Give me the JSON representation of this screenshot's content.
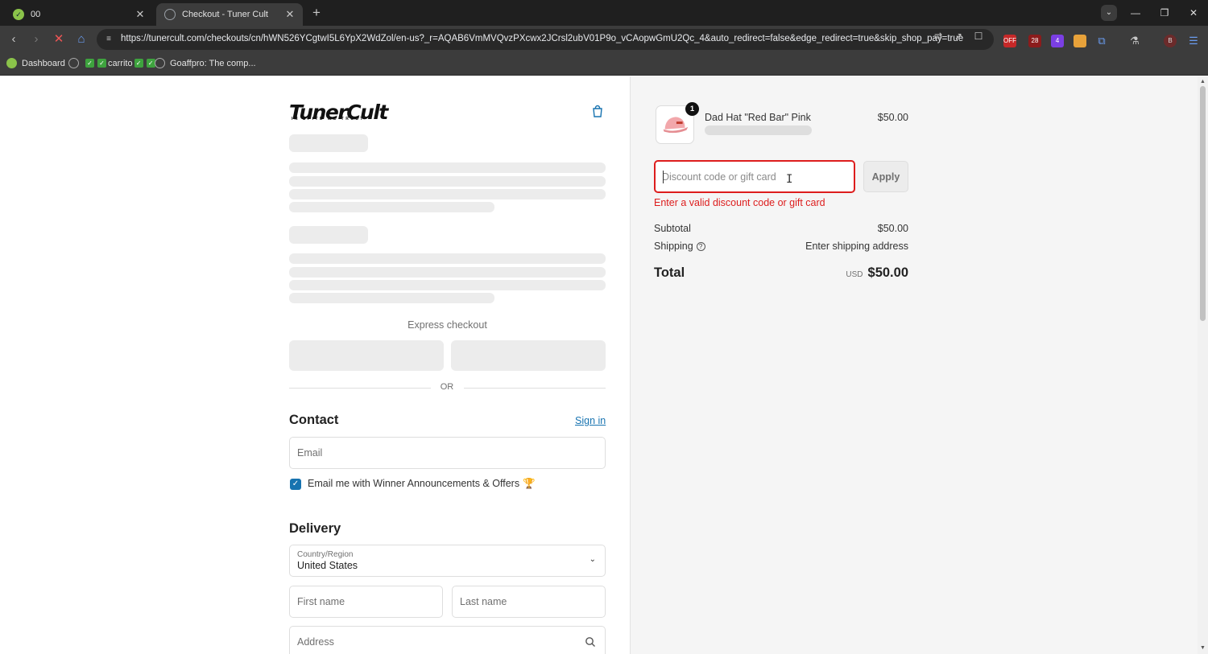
{
  "browser": {
    "tabs": [
      {
        "title": "00",
        "active": false
      },
      {
        "title": "Checkout - Tuner Cult",
        "active": true
      }
    ],
    "url": "https://tunercult.com/checkouts/cn/hWN526YCgtwI5L6YpX2WdZol/en-us?_r=AQAB6VmMVQvzPXcwx2JCrsl2ubV01P9o_vCAopwGmU2Qc_4&auto_redirect=false&edge_redirect=true&skip_shop_pay=true",
    "bookmarks": [
      {
        "label": "Dashboard"
      },
      {
        "label": "carrito"
      },
      {
        "label": "Goaffpro: The comp..."
      }
    ],
    "extension_badges": {
      "off": "OFF",
      "count_28": "28",
      "count_4": "4",
      "profile": "B"
    }
  },
  "checkout": {
    "logo_text": "TunerCult",
    "logo_tagline": "IN SPITE WE TRUST",
    "express_checkout_label": "Express checkout",
    "or_label": "OR",
    "contact": {
      "heading": "Contact",
      "sign_in": "Sign in",
      "email_placeholder": "Email",
      "marketing_label": "Email me with Winner Announcements & Offers",
      "marketing_checked": true
    },
    "delivery": {
      "heading": "Delivery",
      "country_label": "Country/Region",
      "country_value": "United States",
      "first_name_placeholder": "First name",
      "last_name_placeholder": "Last name",
      "address_placeholder": "Address"
    }
  },
  "summary": {
    "product": {
      "quantity": "1",
      "name": "Dad Hat \"Red Bar\" Pink",
      "price": "$50.00"
    },
    "discount": {
      "placeholder": "Discount code or gift card",
      "value": "",
      "apply_label": "Apply",
      "error": "Enter a valid discount code or gift card"
    },
    "subtotal_label": "Subtotal",
    "subtotal_value": "$50.00",
    "shipping_label": "Shipping",
    "shipping_value": "Enter shipping address",
    "total_label": "Total",
    "currency": "USD",
    "total_value": "$50.00"
  },
  "colors": {
    "error": "#dd1d1d",
    "link": "#1773b0",
    "skeleton": "#ececec"
  }
}
